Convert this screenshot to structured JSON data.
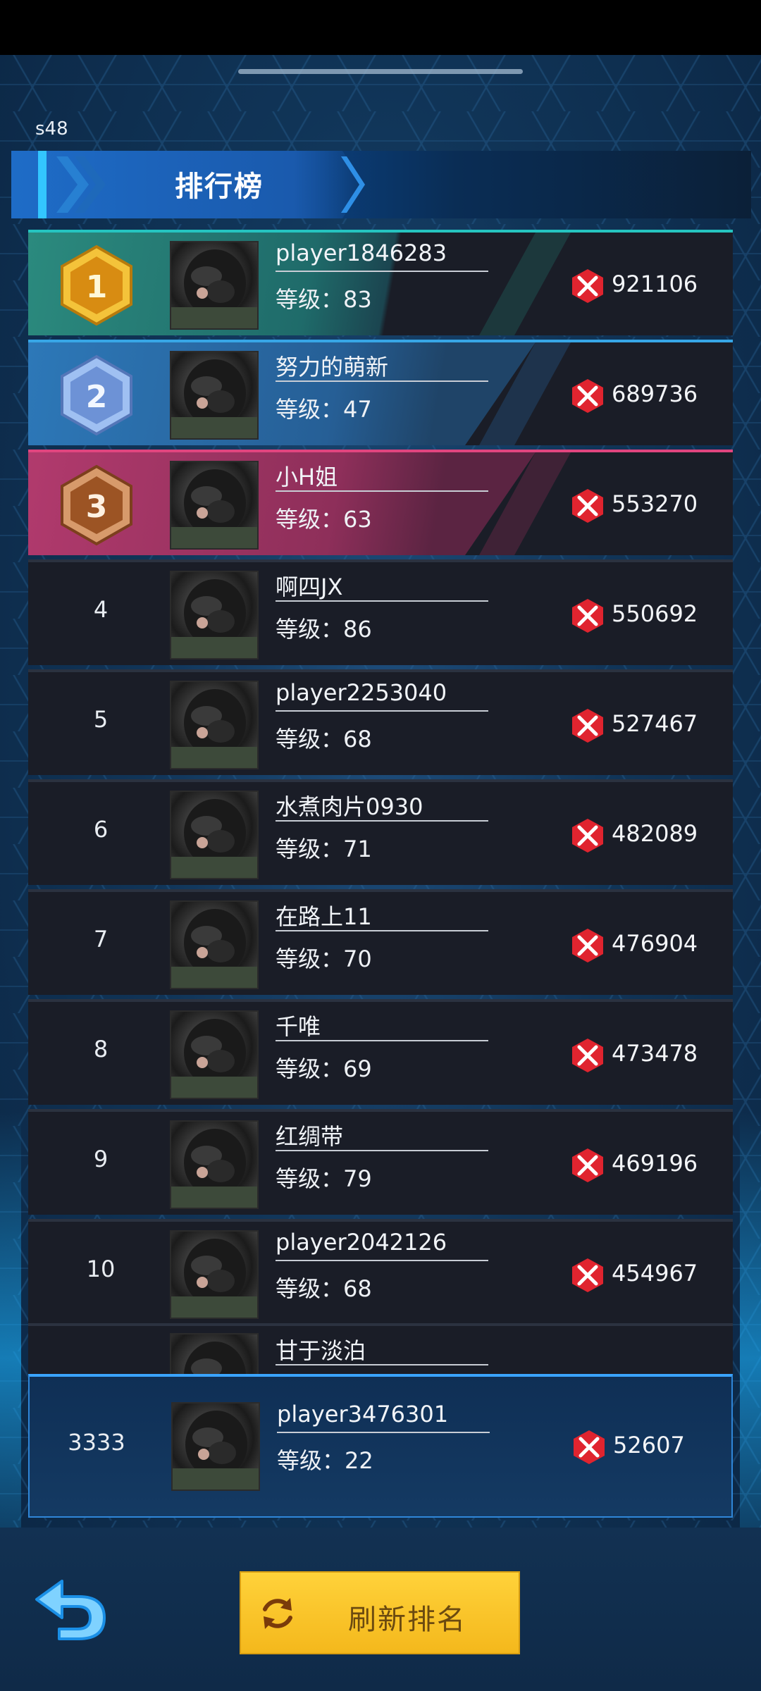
{
  "server_tag": "s48",
  "title": "排行榜",
  "rows": [
    {
      "rank": "1",
      "name": "player1846283",
      "level": "等级：83",
      "power": "921106"
    },
    {
      "rank": "2",
      "name": "努力的萌新",
      "level": "等级：47",
      "power": "689736"
    },
    {
      "rank": "3",
      "name": "小H姐",
      "level": "等级：63",
      "power": "553270"
    },
    {
      "rank": "4",
      "name": "啊四JX",
      "level": "等级：86",
      "power": "550692"
    },
    {
      "rank": "5",
      "name": "player2253040",
      "level": "等级：68",
      "power": "527467"
    },
    {
      "rank": "6",
      "name": "水煮肉片0930",
      "level": "等级：71",
      "power": "482089"
    },
    {
      "rank": "7",
      "name": "在路上11",
      "level": "等级：70",
      "power": "476904"
    },
    {
      "rank": "8",
      "name": "千唯",
      "level": "等级：69",
      "power": "473478"
    },
    {
      "rank": "9",
      "name": "红绸带",
      "level": "等级：79",
      "power": "469196"
    },
    {
      "rank": "10",
      "name": "player2042126",
      "level": "等级：68",
      "power": "454967"
    }
  ],
  "partial_row": {
    "name": "甘于淡泊"
  },
  "self": {
    "rank": "3333",
    "name": "player3476301",
    "level": "等级：22",
    "power": "52607"
  },
  "refresh_label": "刷新排名",
  "icons": {
    "back": "back-arrow-icon",
    "refresh": "refresh-icon",
    "power": "crossed-swords-icon",
    "medal": "rank-medal-icon"
  },
  "colors": {
    "gold": "#f2b01e",
    "silver": "#6f95d8",
    "bronze": "#b36a3a",
    "power_red": "#e0242f",
    "button_yellow": "#ffd23a"
  }
}
